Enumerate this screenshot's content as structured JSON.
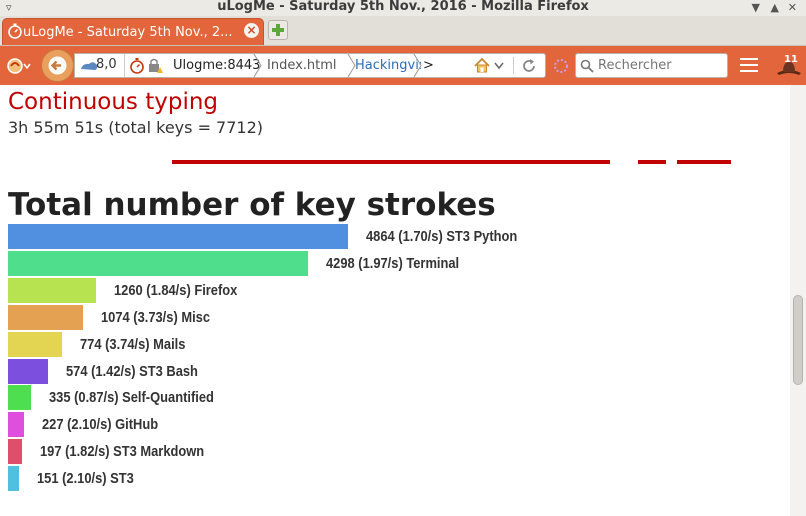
{
  "window": {
    "title": "uLogMe - Saturday 5th Nov., 2016 - Mozilla Firefox"
  },
  "tab": {
    "title": "uLogMe - Saturday 5th Nov., 2..."
  },
  "navbar": {
    "extension_label": "8,0",
    "breadcrumbs": [
      "Ulogme:8443",
      "Index.html",
      "Hackingvis",
      ">"
    ],
    "search_placeholder": "Rechercher",
    "notification_count": "11"
  },
  "continuous": {
    "title": "Continuous typing",
    "stats": "3h 55m 51s (total keys = 7712)"
  },
  "keystrokes": {
    "title": "Total number of key strokes",
    "items": [
      {
        "label": "4864 (1.70/s) ST3 Python",
        "value": 4864,
        "color": "#5190e1"
      },
      {
        "label": "4298 (1.97/s) Terminal",
        "value": 4298,
        "color": "#4fde8c"
      },
      {
        "label": "1260 (1.84/s) Firefox",
        "value": 1260,
        "color": "#b6e34f"
      },
      {
        "label": "1074 (3.73/s) Misc",
        "value": 1074,
        "color": "#e3a151"
      },
      {
        "label": "774 (3.74/s) Mails",
        "value": 774,
        "color": "#e3d551"
      },
      {
        "label": "574 (1.42/s) ST3 Bash",
        "value": 574,
        "color": "#7d4fde"
      },
      {
        "label": "335 (0.87/s) Self-Quantified",
        "value": 335,
        "color": "#4fde4f"
      },
      {
        "label": "227 (2.10/s) GitHub",
        "value": 227,
        "color": "#de4fde"
      },
      {
        "label": "197 (1.82/s) ST3 Markdown",
        "value": 197,
        "color": "#de4f6b"
      },
      {
        "label": "151 (2.10/s) ST3",
        "value": 151,
        "color": "#4fc0de"
      }
    ]
  },
  "colors": {
    "firefox_orange": "#e2653b",
    "accent_red": "#c00000"
  }
}
